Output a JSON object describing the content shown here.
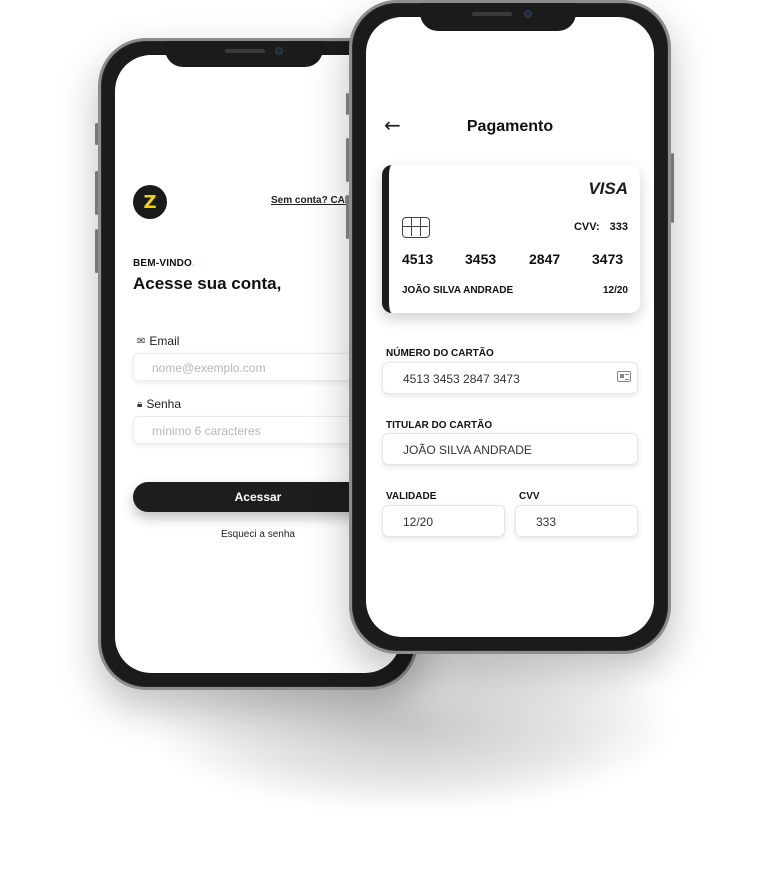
{
  "login": {
    "logo_letter": "Z",
    "signup_link": "Sem conta? CADASTRE-SE",
    "welcome": "BEM-VINDO",
    "welcome_dot": ".",
    "title": "Acesse sua conta,",
    "email_label": "Email",
    "email_placeholder": "nome@exemplo.com",
    "password_label": "Senha",
    "password_placeholder": "mínimo 6 caracteres",
    "submit_label": "Acessar",
    "forgot_label": "Esqueci a senha"
  },
  "payment": {
    "title": "Pagamento",
    "card": {
      "brand": "VISA",
      "cvv_label": "CVV:",
      "cvv_value": "333",
      "number_groups": [
        "4513",
        "3453",
        "2847",
        "3473"
      ],
      "holder": "JOÃO SILVA ANDRADE",
      "expiry": "12/20"
    },
    "fields": {
      "number_label": "NÚMERO DO CARTÃO",
      "number_value": "4513 3453 2847 3473",
      "holder_label": "TITULAR DO CARTÃO",
      "holder_value": "JOÃO SILVA ANDRADE",
      "expiry_label": "VALIDADE",
      "expiry_value": "12/20",
      "cvv_label": "CVV",
      "cvv_value": "333"
    }
  },
  "icons": {
    "logo": "brand-logo-icon",
    "email": "mail-icon",
    "password": "lock-icon",
    "back": "arrow-left-icon",
    "chip": "card-chip-icon",
    "card_field": "credit-card-icon"
  },
  "colors": {
    "accent": "#f2d200",
    "dark": "#1d1d1d"
  }
}
